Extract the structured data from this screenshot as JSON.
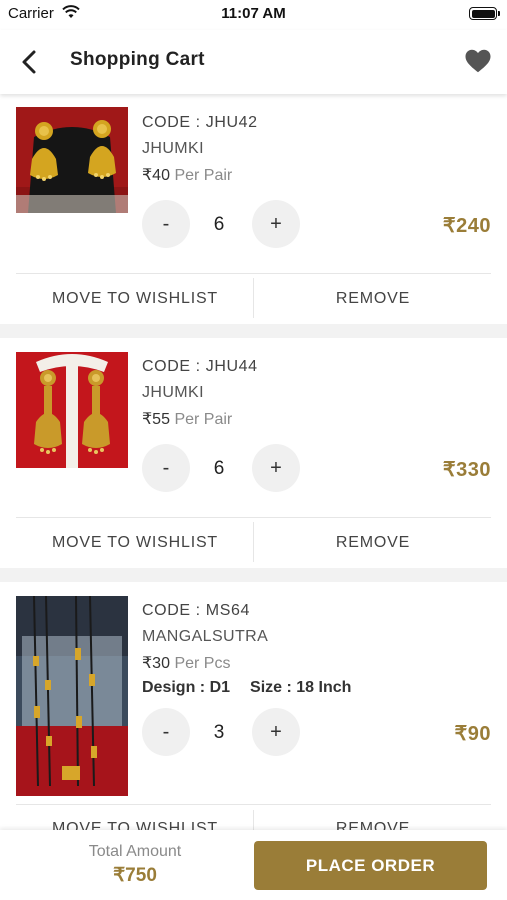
{
  "status_bar": {
    "carrier": "Carrier",
    "time": "11:07 AM"
  },
  "header": {
    "title": "Shopping Cart"
  },
  "cart": {
    "items": [
      {
        "code": "CODE : JHU42",
        "category": "JHUMKI",
        "price": "₹40",
        "price_unit": "Per Pair",
        "quantity": "6",
        "line_total": "₹240",
        "move_label": "MOVE TO WISHLIST",
        "remove_label": "REMOVE"
      },
      {
        "code": "CODE : JHU44",
        "category": "JHUMKI",
        "price": "₹55",
        "price_unit": "Per Pair",
        "quantity": "6",
        "line_total": "₹330",
        "move_label": "MOVE TO WISHLIST",
        "remove_label": "REMOVE"
      },
      {
        "code": "CODE : MS64",
        "category": "MANGALSUTRA",
        "price": "₹30",
        "price_unit": "Per Pcs",
        "design": "Design : D1",
        "size": "Size : 18 Inch",
        "quantity": "3",
        "line_total": "₹90",
        "move_label": "MOVE TO WISHLIST",
        "remove_label": "REMOVE"
      }
    ],
    "minus_label": "-",
    "plus_label": "+"
  },
  "footer": {
    "total_label": "Total Amount",
    "total_value": "₹750",
    "place_order_label": "PLACE ORDER"
  },
  "colors": {
    "accent": "#9a7d38",
    "background": "#f2f2f2"
  }
}
